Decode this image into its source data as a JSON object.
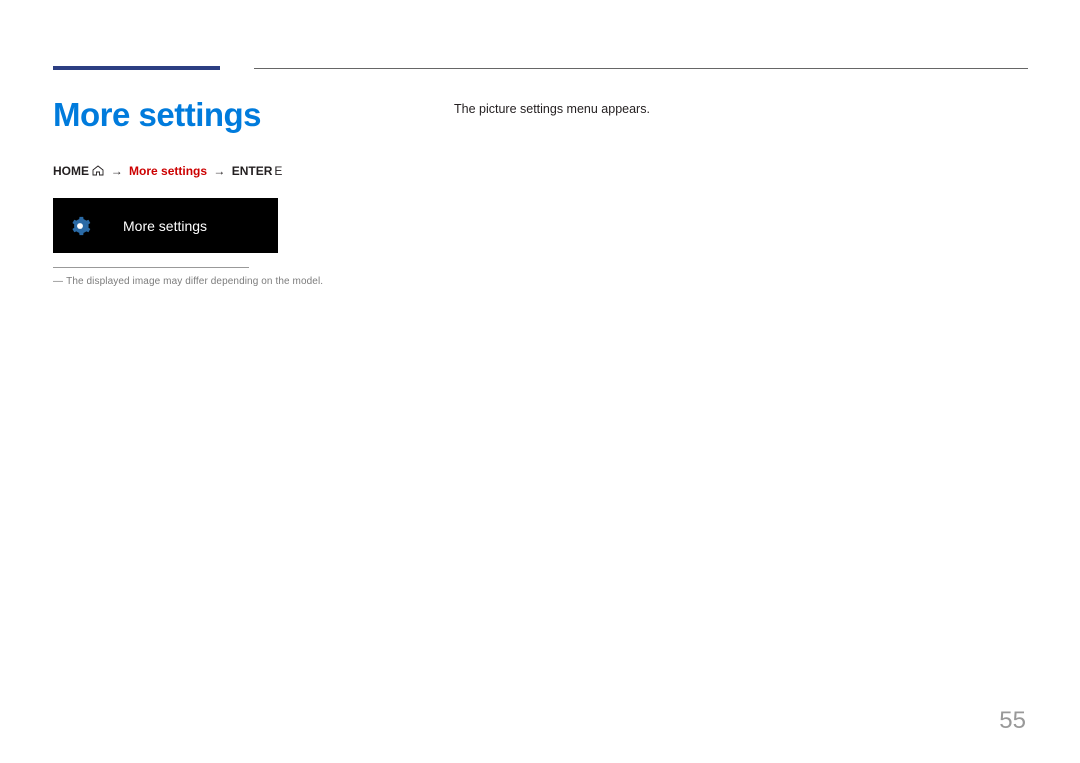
{
  "heading": "More settings",
  "nav": {
    "home": "HOME",
    "path_current": "More settings",
    "enter": "ENTER",
    "arrow": "→"
  },
  "tile": {
    "label": "More settings"
  },
  "note": {
    "dash": "―",
    "text": "The displayed image may differ depending on the model."
  },
  "body": {
    "text": "The picture settings menu appears."
  },
  "page_number": "55"
}
